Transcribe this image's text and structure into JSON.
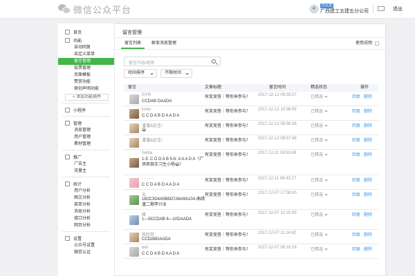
{
  "header": {
    "logo_text": "微信公众平台",
    "account_tag": "已认证",
    "account_name": "广西建工五建五分公司",
    "logout": "退出"
  },
  "sidebar": {
    "home": "首页",
    "groups": [
      {
        "title": "功能",
        "items": [
          "自动回复",
          "自定义菜单",
          "留言管理",
          "投票管理",
          "页面模板",
          "赞赏功能",
          "原创声明功能"
        ]
      },
      {
        "title": "小程序",
        "items": []
      },
      {
        "title": "管理",
        "items": [
          "消息管理",
          "用户管理",
          "素材管理"
        ]
      },
      {
        "title": "推广",
        "items": [
          "广告主",
          "流量主"
        ]
      },
      {
        "title": "统计",
        "items": [
          "用户分析",
          "图文分析",
          "菜单分析",
          "消息分析",
          "接口分析",
          "网页分析"
        ]
      },
      {
        "title": "设置",
        "items": [
          "公众号设置",
          "微信认证"
        ]
      }
    ],
    "active_item": "留言管理",
    "add_plugin": "+ 添加功能插件"
  },
  "main": {
    "title": "留言管理",
    "tabs": [
      "留言列表",
      "群发消息管理"
    ],
    "help": "使用说明",
    "search_placeholder": "留言内容/昵称",
    "sort_select": "时间排序",
    "time_select": "不限时间",
    "columns": [
      "留言",
      "文章标题",
      "留言时间",
      "精选状态",
      "操作"
    ],
    "rows": [
      {
        "user": "GYR",
        "message": "CCDAB DAADA",
        "article": "有奖竞答｜等你来参与！",
        "time": "2017-12-13 09:33:27",
        "status": "已精选",
        "reply": "回复",
        "delete": "删除",
        "avatar": "gray"
      },
      {
        "user": "loner",
        "message": "C C D A B D A A D A",
        "article": "有奖竞答｜等你来参与！",
        "time": "2017-12-12 10:36:55",
        "status": "已精选",
        "reply": "回复",
        "delete": "删除",
        "avatar": "brown"
      },
      {
        "user": "潘潘&赵宝~",
        "message": "😀",
        "article": "有奖竞答｜等你来参与！",
        "time": "2017-12-12 08:58:36",
        "status": "已精选",
        "reply": "回复",
        "delete": "删除",
        "avatar": "tan"
      },
      {
        "user": "潘潘&赵宝~",
        "message": "",
        "article": "有奖竞答｜等你来参与！",
        "time": "2017-12-12 08:57:46",
        "status": "已精选",
        "reply": "回复",
        "delete": "删除",
        "avatar": "tan"
      },
      {
        "user": "Selba",
        "message": "1-5: C D D A B 5-6: A A A D A（广场项目实习生小杨😀）",
        "article": "有奖竞答｜等你来参与！",
        "time": "2017-12-11 09:53:49",
        "status": "已精选",
        "reply": "回复",
        "delete": "删除",
        "avatar": "brown"
      },
      {
        "user": "- - - - -",
        "message": "C C D A B D A A D A",
        "article": "有奖竞答｜等你来参与！",
        "time": "2017-12-11 06:43:27",
        "status": "已精选",
        "reply": "回复",
        "delete": "删除",
        "avatar": "pink"
      },
      {
        "user": "业",
        "message": "1B2C3D4A5B6D7A8A9A10A 曲靖潼二期李兴业",
        "article": "有奖竞答｜等你来参与！",
        "time": "2017-12-07 17:08:00",
        "status": "已精选",
        "reply": "回复",
        "delete": "删除",
        "avatar": "green"
      },
      {
        "user": "峰",
        "message": "1—5CCDAB 6—10DAADA",
        "article": "有奖竞答｜等你来参与！",
        "time": "2017-12-07 12:25:05",
        "status": "已精选",
        "reply": "回复",
        "delete": "删除",
        "avatar": "blue"
      },
      {
        "user": "风吹苍",
        "message": "CCDABDAADA",
        "article": "有奖竞答｜等你来参与！",
        "time": "2017-12-07 11:24:42",
        "status": "已精选",
        "reply": "回复",
        "delete": "删除",
        "avatar": "tan"
      },
      {
        "user": "wei",
        "message": "C C D A B D A A D A",
        "article": "有奖竞答｜等你来参与！",
        "time": "2017-12-07 08:18:16",
        "status": "已精选",
        "reply": "回复",
        "delete": "删除",
        "avatar": "gray"
      }
    ]
  }
}
